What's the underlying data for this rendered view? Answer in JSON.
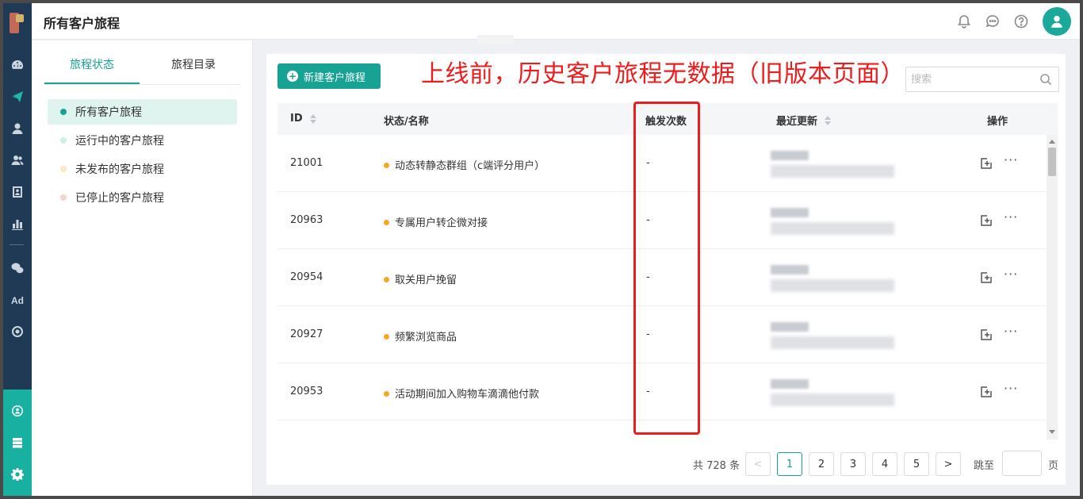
{
  "header": {
    "title": "所有客户旅程"
  },
  "sidebar": {
    "tabs": [
      {
        "label": "旅程状态",
        "active": true
      },
      {
        "label": "旅程目录",
        "active": false
      }
    ],
    "items": [
      {
        "label": "所有客户旅程",
        "dot_color": "#17a394",
        "active": true
      },
      {
        "label": "运行中的客户旅程",
        "dot_color": "#cfeee7",
        "active": false
      },
      {
        "label": "未发布的客户旅程",
        "dot_color": "#fbe8c4",
        "active": false
      },
      {
        "label": "已停止的客户旅程",
        "dot_color": "#f6d3d0",
        "active": false
      }
    ]
  },
  "toolbar": {
    "new_button_label": "新建客户旅程",
    "search_placeholder": "搜索"
  },
  "annotation": "上线前，历史客户旅程无数据（旧版本页面）",
  "table": {
    "columns": {
      "id": "ID",
      "name": "状态/名称",
      "triggers": "触发次数",
      "updated": "最近更新",
      "actions": "操作"
    },
    "rows": [
      {
        "id": "21001",
        "name": "动态转静态群组（c端评分用户）",
        "triggers": "-",
        "status_color": "#f5a623"
      },
      {
        "id": "20963",
        "name": "专属用户转企微对接",
        "triggers": "-",
        "status_color": "#f5a623"
      },
      {
        "id": "20954",
        "name": "取关用户挽留",
        "triggers": "-",
        "status_color": "#f5a623"
      },
      {
        "id": "20927",
        "name": "频繁浏览商品",
        "triggers": "-",
        "status_color": "#f5a623"
      },
      {
        "id": "20953",
        "name": "活动期间加入购物车滴滴他付款",
        "triggers": "-",
        "status_color": "#f5a623"
      }
    ]
  },
  "pagination": {
    "total_text": "共 728 条",
    "prev": "<",
    "pages": [
      "1",
      "2",
      "3",
      "4",
      "5"
    ],
    "current": "1",
    "next": ">",
    "jump_label": "跳至",
    "page_unit": "页"
  },
  "colors": {
    "accent": "#17a394",
    "rail": "#203a55",
    "annotation_red": "#ee1c1c"
  }
}
